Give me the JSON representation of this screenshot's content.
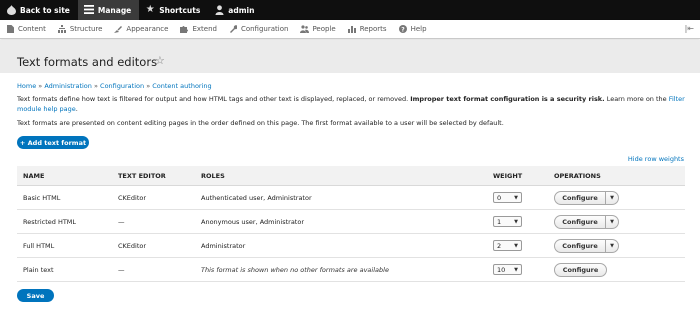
{
  "toolbar": {
    "back_label": "Back to site",
    "manage_label": "Manage",
    "shortcuts_label": "Shortcuts",
    "user_label": "admin"
  },
  "menu": {
    "items": [
      {
        "label": "Content",
        "icon": "file-icon"
      },
      {
        "label": "Structure",
        "icon": "sitemap-icon"
      },
      {
        "label": "Appearance",
        "icon": "brush-icon"
      },
      {
        "label": "Extend",
        "icon": "puzzle-icon"
      },
      {
        "label": "Configuration",
        "icon": "wrench-icon"
      },
      {
        "label": "People",
        "icon": "people-icon"
      },
      {
        "label": "Reports",
        "icon": "chart-icon"
      },
      {
        "label": "Help",
        "icon": "help-icon"
      }
    ]
  },
  "page": {
    "title": "Text formats and editors"
  },
  "breadcrumb": [
    "Home",
    "Administration",
    "Configuration",
    "Content authoring"
  ],
  "intro": {
    "text_before": "Text formats define how text is filtered for output and how HTML tags and other text is displayed, replaced, or removed.",
    "warning": "Improper text format configuration is a security risk.",
    "text_more": "Learn more on the",
    "link_label": "Filter module help page",
    "end": "."
  },
  "order_note": "Text formats are presented on content editing pages in the order defined on this page. The first format available to a user will be selected by default.",
  "add_button": "+ Add text format",
  "hide_weights": "Hide row weights",
  "table": {
    "headers": {
      "name": "NAME",
      "editor": "TEXT EDITOR",
      "roles": "ROLES",
      "weight": "WEIGHT",
      "operations": "OPERATIONS"
    },
    "rows": [
      {
        "name": "Basic HTML",
        "editor": "CKEditor",
        "roles": "Authenticated user, Administrator",
        "weight": "0",
        "op": "Configure",
        "has_dropdown": true
      },
      {
        "name": "Restricted HTML",
        "editor": "—",
        "roles": "Anonymous user, Administrator",
        "weight": "1",
        "op": "Configure",
        "has_dropdown": true
      },
      {
        "name": "Full HTML",
        "editor": "CKEditor",
        "roles": "Administrator",
        "weight": "2",
        "op": "Configure",
        "has_dropdown": true
      },
      {
        "name": "Plain text",
        "editor": "—",
        "roles": "This format is shown when no other formats are available",
        "weight": "10",
        "op": "Configure",
        "has_dropdown": false
      }
    ]
  },
  "save_button": "Save",
  "colors": {
    "accent": "#0074bd",
    "toolbar": "#0f0f0f",
    "header_bg": "#ebebeb"
  }
}
